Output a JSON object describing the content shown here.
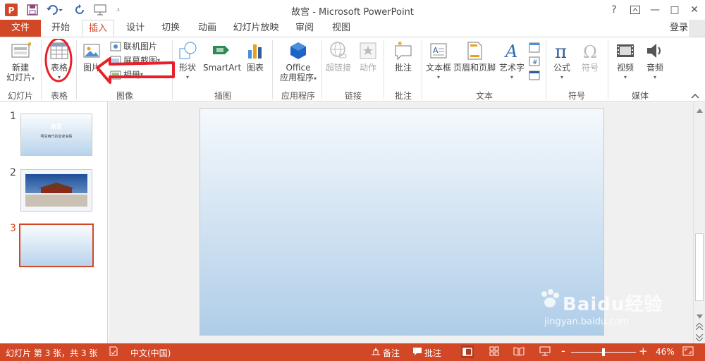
{
  "window": {
    "title": "故宫 - Microsoft PowerPoint",
    "help": "?",
    "minimize": "—",
    "restore": "□",
    "close": "✕"
  },
  "tabs": {
    "file": "文件",
    "items": [
      "开始",
      "插入",
      "设计",
      "切换",
      "动画",
      "幻灯片放映",
      "审阅",
      "视图"
    ],
    "login": "登录"
  },
  "ribbon": {
    "new_slide": "新建",
    "new_slide_2": "幻灯片",
    "table": "表格",
    "picture": "图片",
    "online_picture": "联机图片",
    "screenshot": "屏幕截图",
    "album": "相册",
    "shapes": "形状",
    "smartart": "SmartArt",
    "chart": "图表",
    "office_apps_1": "Office",
    "office_apps_2": "应用程序",
    "hyperlink": "超链接",
    "action": "动作",
    "comment": "批注",
    "textbox": "文本框",
    "header_footer": "页眉和页脚",
    "wordart": "艺术字",
    "equation": "公式",
    "symbol": "符号",
    "video": "视频",
    "audio": "音频",
    "groups": {
      "slides": "幻灯片",
      "tables": "表格",
      "images": "图像",
      "illustrations": "插图",
      "apps": "应用程序",
      "links": "链接",
      "comments": "批注",
      "text": "文本",
      "symbols": "符号",
      "media": "媒体"
    }
  },
  "slides": {
    "numbers": [
      "1",
      "2",
      "3"
    ],
    "slide1_title": "故宫",
    "slide1_subtitle": "明清两代的皇家宫殿",
    "selected": 3
  },
  "status": {
    "slide_info": "幻灯片 第 3 张，共 3 张",
    "language": "中文(中国)",
    "notes": "备注",
    "comments": "批注",
    "zoom": "46%",
    "zoom_minus": "-",
    "zoom_plus": "+"
  },
  "watermark": {
    "brand": "Baidu经验",
    "url": "jingyan.baidu.com"
  },
  "colors": {
    "accent": "#d24726",
    "annotation": "#e8202a"
  }
}
